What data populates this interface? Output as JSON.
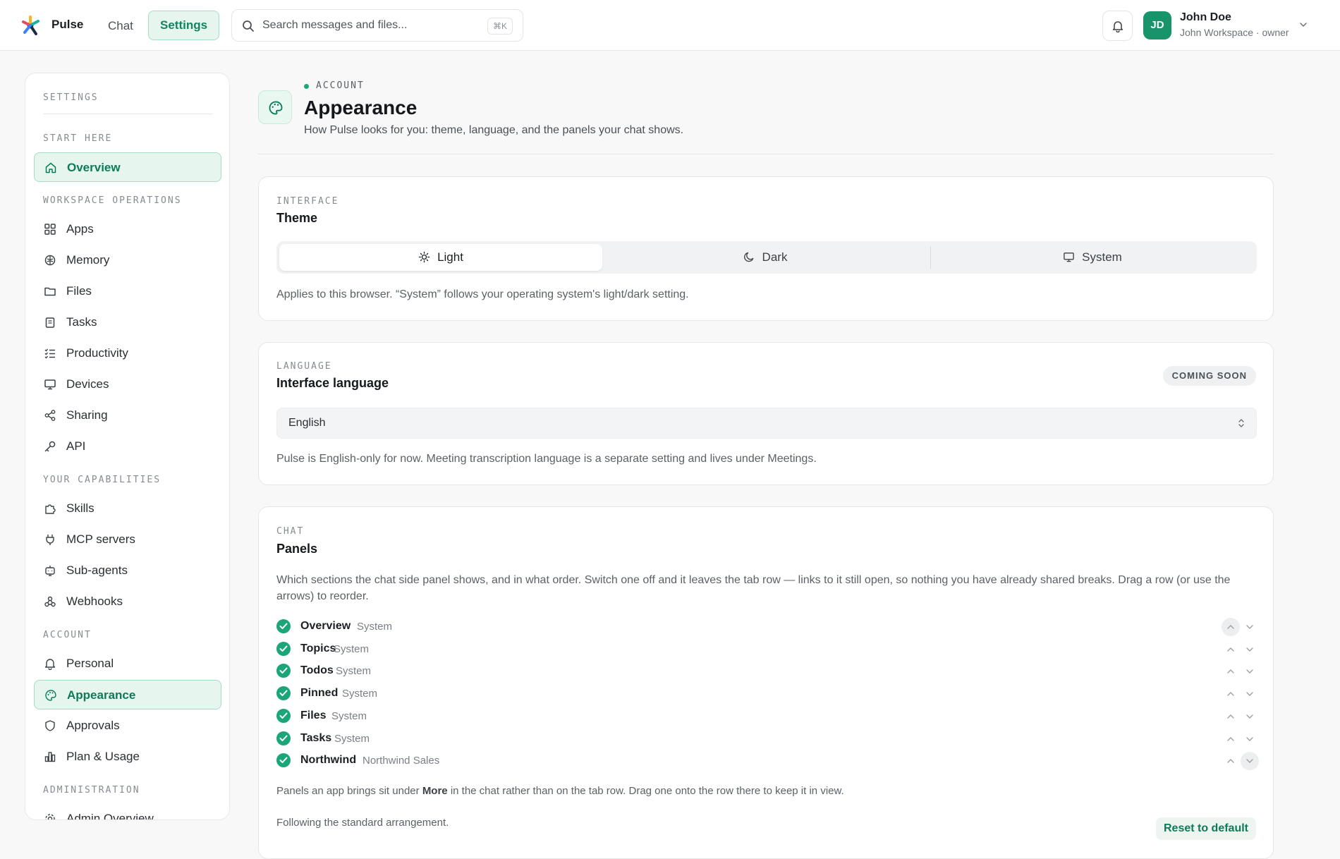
{
  "app": {
    "name": "Pulse"
  },
  "topnav": {
    "chat": "Chat",
    "settings": "Settings"
  },
  "search": {
    "placeholder": "Search messages and files...",
    "shortcut": "⌘K"
  },
  "user": {
    "initials": "JD",
    "name": "John Doe",
    "subtitle": "John Workspace · owner"
  },
  "sidebar": {
    "title": "SETTINGS",
    "groups": {
      "start": "START HERE",
      "workspace": "WORKSPACE OPERATIONS",
      "capabilities": "YOUR CAPABILITIES",
      "account": "ACCOUNT",
      "admin": "ADMINISTRATION"
    },
    "items": {
      "overview": "Overview",
      "apps": "Apps",
      "memory": "Memory",
      "files": "Files",
      "tasks": "Tasks",
      "productivity": "Productivity",
      "devices": "Devices",
      "sharing": "Sharing",
      "api": "API",
      "skills": "Skills",
      "mcp": "MCP servers",
      "subagents": "Sub-agents",
      "webhooks": "Webhooks",
      "personal": "Personal",
      "appearance": "Appearance",
      "approvals": "Approvals",
      "plan": "Plan & Usage",
      "admin_overview": "Admin Overview"
    }
  },
  "header": {
    "eyebrow": "ACCOUNT",
    "title": "Appearance",
    "subtitle": "How Pulse looks for you: theme, language, and the panels your chat shows."
  },
  "theme_card": {
    "eyebrow": "INTERFACE",
    "title": "Theme",
    "options": {
      "light": "Light",
      "dark": "Dark",
      "system": "System"
    },
    "selected": "Light",
    "note": "Applies to this browser. “System” follows your operating system's light/dark setting."
  },
  "language_card": {
    "eyebrow": "LANGUAGE",
    "title": "Interface language",
    "badge": "COMING SOON",
    "value": "English",
    "note": "Pulse is English-only for now. Meeting transcription language is a separate setting and lives under Meetings."
  },
  "panels_card": {
    "eyebrow": "CHAT",
    "title": "Panels",
    "description": "Which sections the chat side panel shows, and in what order. Switch one off and it leaves the tab row — links to it still open, so nothing you have already shared breaks. Drag a row (or use the arrows) to reorder.",
    "panels": [
      {
        "name": "Overview",
        "source": "System",
        "enabled": true
      },
      {
        "name": "Topics",
        "source": "System",
        "enabled": true
      },
      {
        "name": "Todos",
        "source": "System",
        "enabled": true
      },
      {
        "name": "Pinned",
        "source": "System",
        "enabled": true
      },
      {
        "name": "Files",
        "source": "System",
        "enabled": true
      },
      {
        "name": "Tasks",
        "source": "System",
        "enabled": true
      },
      {
        "name": "Northwind",
        "source": "Northwind Sales",
        "enabled": true
      }
    ],
    "more_note_before": "Panels an app brings sit under ",
    "more_note_bold": "More",
    "more_note_after": " in the chat rather than on the tab row. Drag one onto the row there to keep it in view.",
    "status": "Following the standard arrangement.",
    "reset_label": "Reset to default"
  },
  "colors": {
    "accent": "#1aa677",
    "accent_text": "#0f7a57",
    "accent_bg": "#e6f6ef"
  }
}
